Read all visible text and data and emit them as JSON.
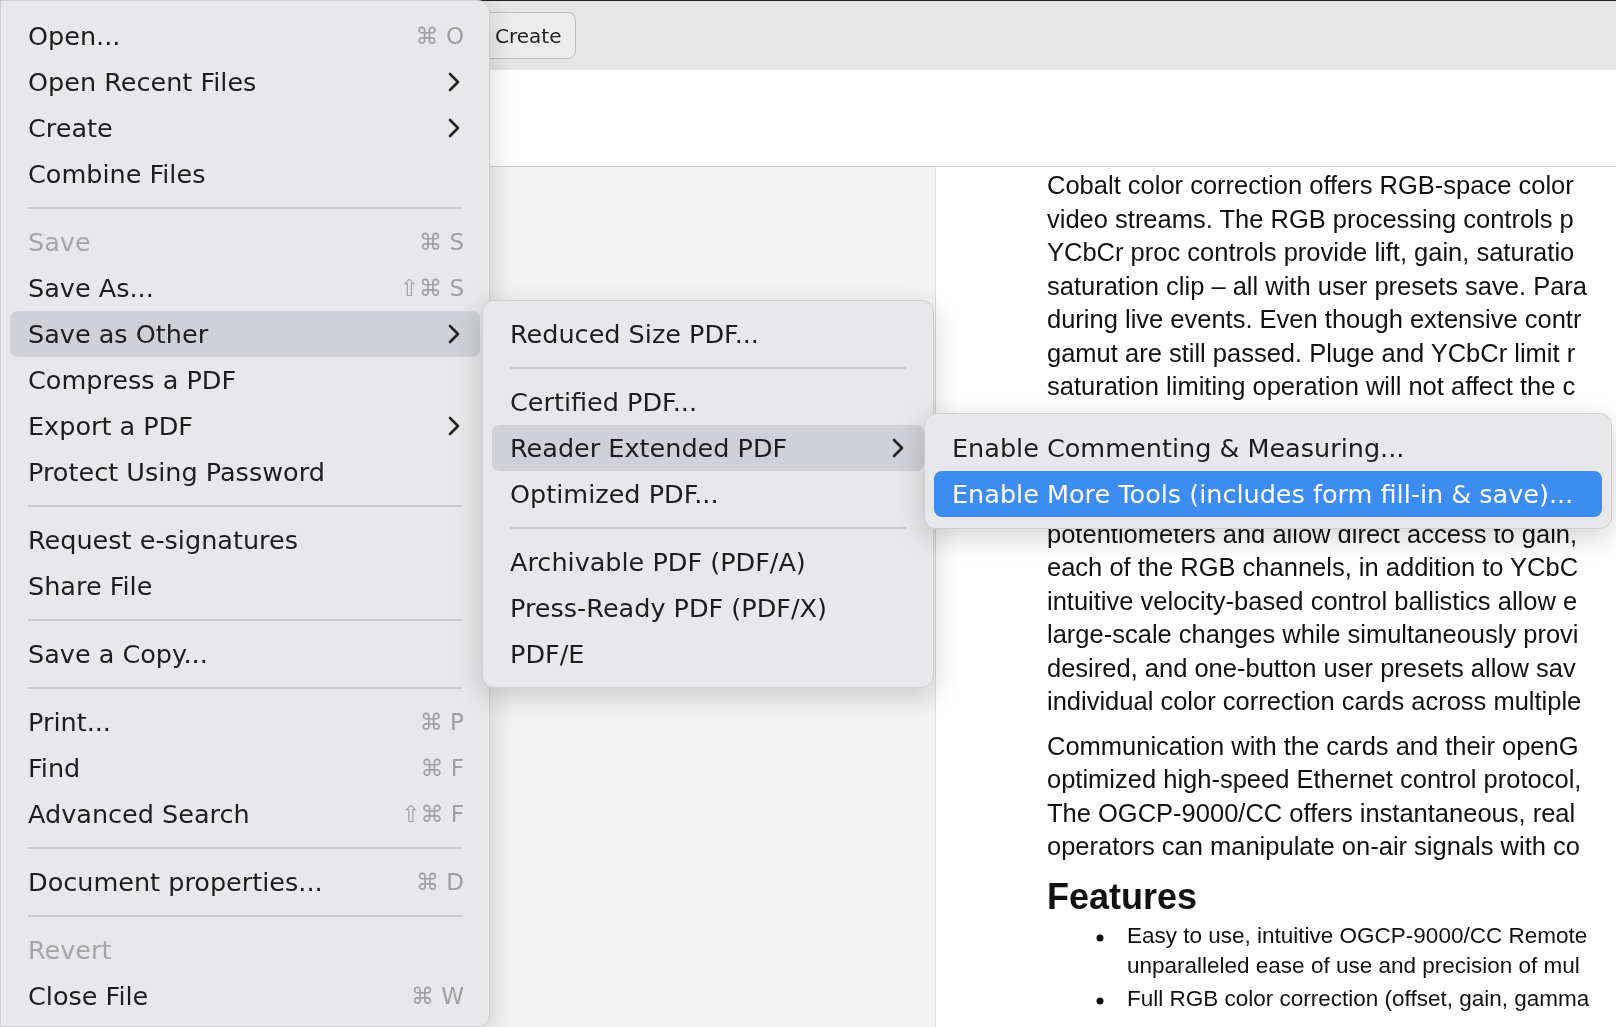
{
  "toolbar": {
    "buttons": [
      {
        "label": "Create"
      }
    ]
  },
  "document": {
    "blocks": [
      {
        "lines": [
          "Cobalt color correction offers RGB-space color",
          "video streams. The RGB processing controls p",
          "YCbCr proc controls provide lift, gain, saturatio",
          "saturation clip – all with user presets save. Para",
          "during live events. Even though extensive contr",
          "gamut are still passed. Pluge and YCbCr limit r",
          "saturation limiting operation will not affect the c"
        ]
      },
      {
        "lines": [
          "potentiometers and allow direct access to gain,",
          "each of the RGB channels, in addition to YCbC",
          "intuitive velocity-based control ballistics allow e",
          "large-scale changes while simultaneously provi",
          "desired, and one-button user presets allow sav",
          "individual color correction cards across multiple"
        ]
      },
      {
        "lines": [
          "Communication with the cards and their openG",
          "optimized high-speed Ethernet control protocol,",
          "The OGCP-9000/CC offers instantaneous, real",
          "operators can manipulate on-air signals with co"
        ]
      }
    ],
    "heading": "Features",
    "bullets": [
      {
        "lines": [
          "Easy to use, intuitive OGCP-9000/CC Remote",
          "unparalleled ease of use and precision of mul"
        ]
      },
      {
        "lines": [
          "Full RGB color correction (offset, gain, gamma"
        ]
      }
    ]
  },
  "file_menu": {
    "items": [
      {
        "kind": "item",
        "label": "Open...",
        "shortcut": "⌘ O",
        "submenu": false,
        "disabled": false,
        "selected": false
      },
      {
        "kind": "item",
        "label": "Open Recent Files",
        "submenu": true,
        "disabled": false,
        "selected": false
      },
      {
        "kind": "item",
        "label": "Create",
        "submenu": true,
        "disabled": false,
        "selected": false
      },
      {
        "kind": "item",
        "label": "Combine Files",
        "submenu": false,
        "disabled": false,
        "selected": false
      },
      {
        "kind": "separator"
      },
      {
        "kind": "item",
        "label": "Save",
        "shortcut": "⌘ S",
        "submenu": false,
        "disabled": true,
        "selected": false
      },
      {
        "kind": "item",
        "label": "Save As...",
        "shortcut": "⇧⌘ S",
        "submenu": false,
        "disabled": false,
        "selected": false
      },
      {
        "kind": "item",
        "label": "Save as Other",
        "submenu": true,
        "disabled": false,
        "selected": true
      },
      {
        "kind": "item",
        "label": "Compress a PDF",
        "submenu": false,
        "disabled": false,
        "selected": false
      },
      {
        "kind": "item",
        "label": "Export a PDF",
        "submenu": true,
        "disabled": false,
        "selected": false
      },
      {
        "kind": "item",
        "label": "Protect Using Password",
        "submenu": false,
        "disabled": false,
        "selected": false
      },
      {
        "kind": "separator"
      },
      {
        "kind": "item",
        "label": "Request e-signatures",
        "submenu": false,
        "disabled": false,
        "selected": false
      },
      {
        "kind": "item",
        "label": "Share File",
        "submenu": false,
        "disabled": false,
        "selected": false
      },
      {
        "kind": "separator"
      },
      {
        "kind": "item",
        "label": "Save a Copy...",
        "submenu": false,
        "disabled": false,
        "selected": false
      },
      {
        "kind": "separator"
      },
      {
        "kind": "item",
        "label": "Print...",
        "shortcut": "⌘ P",
        "submenu": false,
        "disabled": false,
        "selected": false
      },
      {
        "kind": "item",
        "label": "Find",
        "shortcut": "⌘ F",
        "submenu": false,
        "disabled": false,
        "selected": false
      },
      {
        "kind": "item",
        "label": "Advanced Search",
        "shortcut": "⇧⌘ F",
        "submenu": false,
        "disabled": false,
        "selected": false
      },
      {
        "kind": "separator"
      },
      {
        "kind": "item",
        "label": "Document properties...",
        "shortcut": "⌘ D",
        "submenu": false,
        "disabled": false,
        "selected": false
      },
      {
        "kind": "separator"
      },
      {
        "kind": "item",
        "label": "Revert",
        "submenu": false,
        "disabled": true,
        "selected": false
      },
      {
        "kind": "item",
        "label": "Close File",
        "shortcut": "⌘ W",
        "submenu": false,
        "disabled": false,
        "selected": false
      }
    ]
  },
  "save_as_other_menu": {
    "items": [
      {
        "kind": "item",
        "label": "Reduced Size PDF...",
        "submenu": false,
        "disabled": false,
        "selected": false
      },
      {
        "kind": "separator"
      },
      {
        "kind": "item",
        "label": "Certified PDF...",
        "submenu": false,
        "disabled": false,
        "selected": false
      },
      {
        "kind": "item",
        "label": "Reader Extended PDF",
        "submenu": true,
        "disabled": false,
        "selected": true
      },
      {
        "kind": "item",
        "label": "Optimized PDF...",
        "submenu": false,
        "disabled": false,
        "selected": false
      },
      {
        "kind": "separator"
      },
      {
        "kind": "item",
        "label": "Archivable PDF (PDF/A)",
        "submenu": false,
        "disabled": false,
        "selected": false
      },
      {
        "kind": "item",
        "label": "Press-Ready PDF (PDF/X)",
        "submenu": false,
        "disabled": false,
        "selected": false
      },
      {
        "kind": "item",
        "label": "PDF/E",
        "submenu": false,
        "disabled": false,
        "selected": false
      }
    ]
  },
  "reader_extended_menu": {
    "items": [
      {
        "kind": "item",
        "label": "Enable Commenting & Measuring...",
        "submenu": false,
        "disabled": false,
        "selected": false
      },
      {
        "kind": "item",
        "label": "Enable More Tools (includes form fill-in & save)...",
        "submenu": false,
        "disabled": false,
        "selected": true
      }
    ]
  }
}
